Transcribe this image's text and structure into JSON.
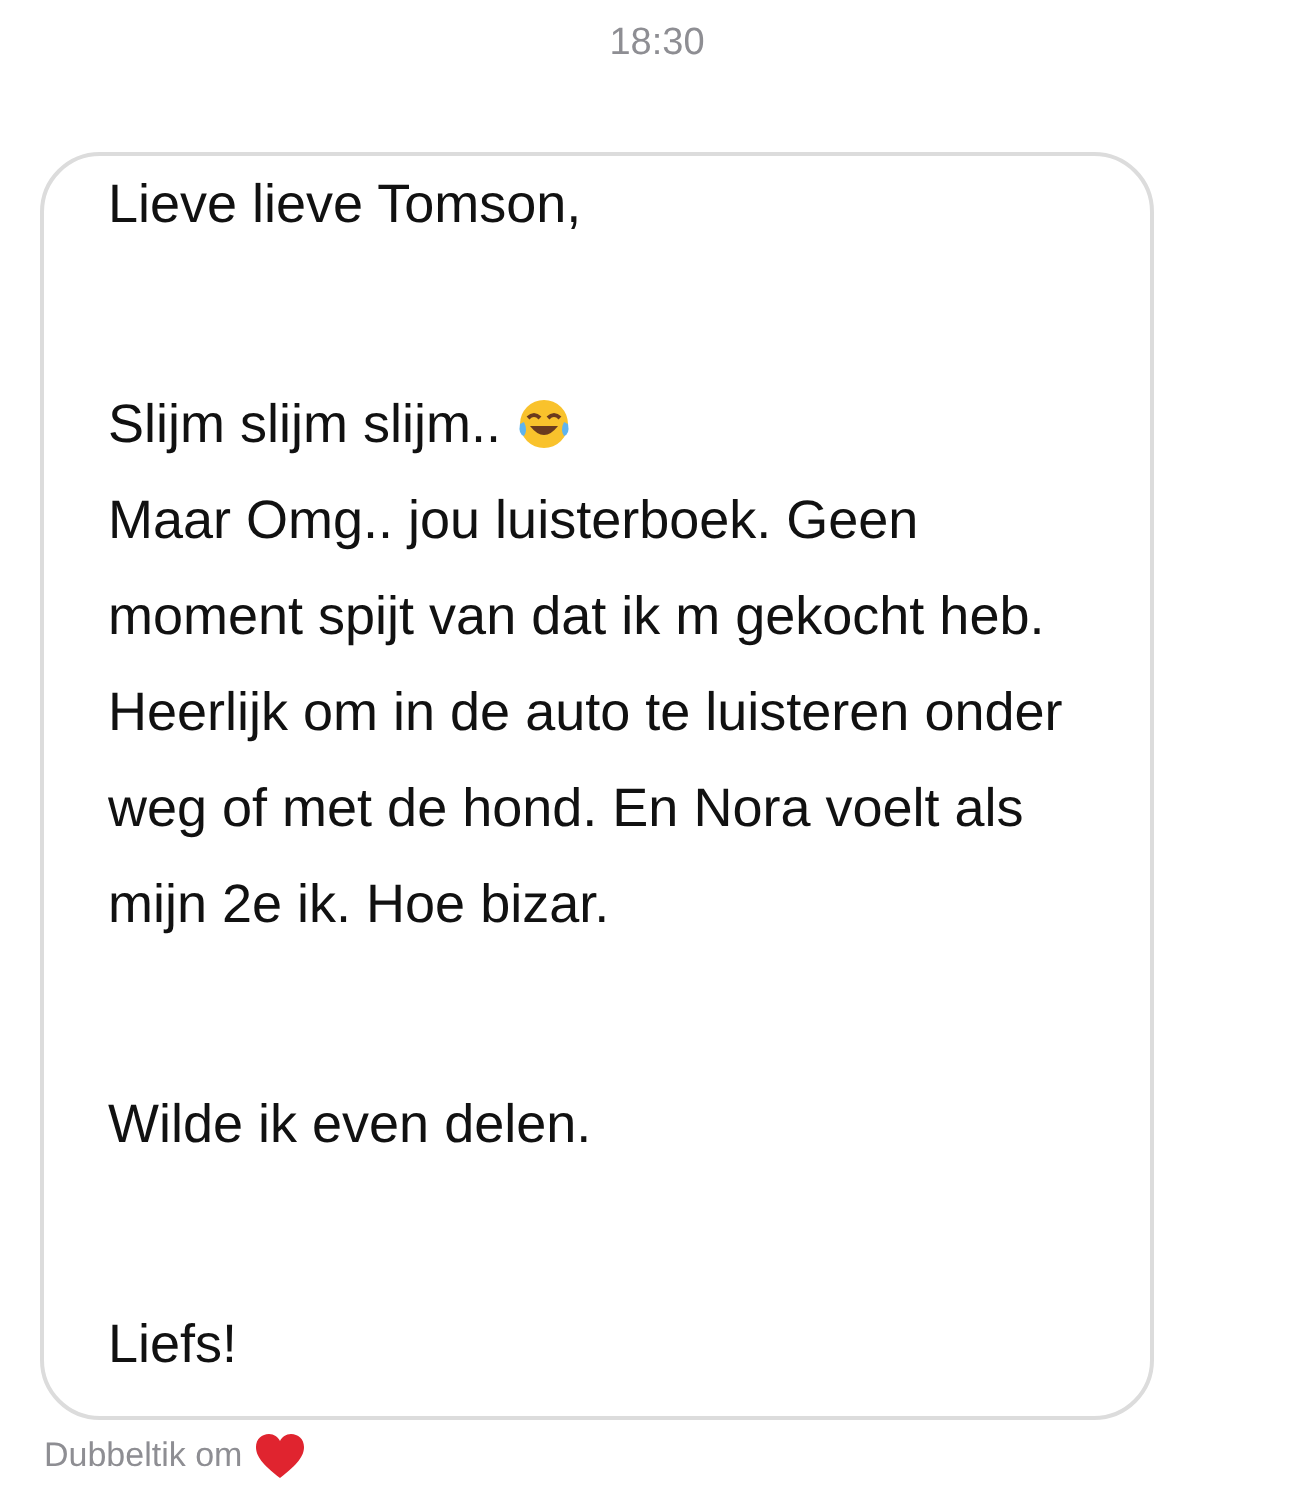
{
  "timestamp": "18:30",
  "message": {
    "paragraphs": [
      {
        "lines": [
          {
            "kind": "text",
            "text": "Lieve lieve Tomson,"
          }
        ]
      },
      {
        "lines": [
          {
            "kind": "text_with_emoji",
            "text": "Slijm slijm slijm.."
          },
          {
            "kind": "text",
            "text": "Maar Omg.. jou luisterboek. Geen moment spijt van dat ik m gekocht heb. Heerlijk om in de auto te luisteren onder weg of met de hond. En Nora voelt als mijn 2e ik. Hoe bizar."
          }
        ]
      },
      {
        "lines": [
          {
            "kind": "text",
            "text": "Wilde ik even delen."
          }
        ]
      },
      {
        "lines": [
          {
            "kind": "text",
            "text": "Liefs!"
          }
        ]
      }
    ]
  },
  "hint": {
    "text": "Dubbeltik om"
  }
}
